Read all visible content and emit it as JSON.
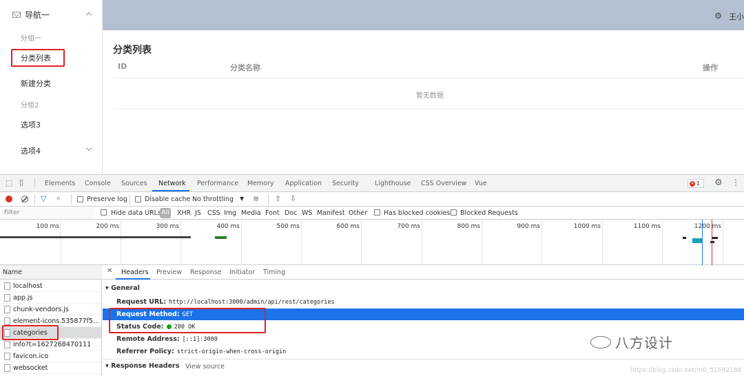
{
  "sidebar": {
    "nav_title": "导航一",
    "group1": "分组一",
    "item_category_list": "分类列表",
    "item_new_category": "新建分类",
    "group2": "分组2",
    "item_option3": "选项3",
    "item_option4": "选项4"
  },
  "header": {
    "user": "王小"
  },
  "main": {
    "title": "分类列表",
    "columns": [
      "ID",
      "分类名称",
      "操作"
    ],
    "empty_text": "暂无数据"
  },
  "devtools": {
    "tabs": [
      "Elements",
      "Console",
      "Sources",
      "Network",
      "Performance",
      "Memory",
      "Application",
      "Security",
      "Lighthouse",
      "CSS Overview",
      "Vue"
    ],
    "active_tab": "Network",
    "error_count": "1",
    "toolbar": {
      "preserve_log": "Preserve log",
      "disable_cache": "Disable cache",
      "throttling": "No throttling"
    },
    "filter": {
      "placeholder": "Filter",
      "hide_data_urls": "Hide data URLs",
      "types": [
        "All",
        "XHR",
        "JS",
        "CSS",
        "Img",
        "Media",
        "Font",
        "Doc",
        "WS",
        "Manifest",
        "Other"
      ],
      "has_blocked_cookies": "Has blocked cookies",
      "blocked_requests": "Blocked Requests"
    },
    "timeline_ticks": [
      "100 ms",
      "200 ms",
      "300 ms",
      "400 ms",
      "500 ms",
      "600 ms",
      "700 ms",
      "800 ms",
      "900 ms",
      "1000 ms",
      "1100 ms",
      "1200 ms"
    ],
    "name_header": "Name",
    "requests": [
      "localhost",
      "app.js",
      "chunk-vendors.js",
      "element-icons.535877f5.w...",
      "categories",
      "info?t=1627268470111",
      "favicon.ico",
      "websocket"
    ],
    "selected_request": "categories",
    "detail_tabs": [
      "Headers",
      "Preview",
      "Response",
      "Initiator",
      "Timing"
    ],
    "active_detail_tab": "Headers",
    "general_label": "General",
    "general": {
      "request_url_label": "Request URL:",
      "request_url": "http://localhost:3000/admin/api/rest/categories",
      "request_method_label": "Request Method:",
      "request_method": "GET",
      "status_code_label": "Status Code:",
      "status_code": "200 OK",
      "remote_address_label": "Remote Address:",
      "remote_address": "[::1]:3000",
      "referrer_policy_label": "Referrer Policy:",
      "referrer_policy": "strict-origin-when-cross-origin"
    },
    "response_headers_label": "Response Headers",
    "view_source": "View source"
  },
  "watermark": {
    "brand": "八方设计",
    "url": "https://blog.csdn.net/m0_51592188"
  },
  "colors": {
    "header_bg": "#b3c0d1",
    "highlight_blue": "#1a73e8",
    "annotation_red": "#e02020",
    "status_green": "#0ca40c"
  }
}
